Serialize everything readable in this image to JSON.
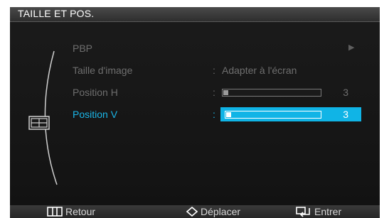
{
  "header": {
    "title": "TAILLE ET POS."
  },
  "menu": {
    "items": [
      {
        "label": "PBP",
        "value": "",
        "has_submenu": true
      },
      {
        "label": "Taille d'image",
        "colon": ":",
        "value": "Adapter à l'écran"
      },
      {
        "label": "Position H",
        "colon": ":",
        "level": 3,
        "value_text": "3",
        "fill_fraction": 0.05
      },
      {
        "label": "Position V",
        "colon": ":",
        "level": 3,
        "value_text": "3",
        "fill_fraction": 0.05,
        "selected": true
      }
    ]
  },
  "icons": {
    "section": "position-size-icon",
    "submenu": "right-triangle-icon",
    "back": "menu-bars-icon",
    "move": "diamond-arrows-icon",
    "enter": "enter-icon"
  },
  "footer": {
    "back_label": "Retour",
    "move_label": "Déplacer",
    "enter_label": "Entrer"
  },
  "colors": {
    "accent": "#10b4e6",
    "background": "#141414",
    "text_dim": "#6e6e6e",
    "text_light": "#d8d8d8"
  }
}
